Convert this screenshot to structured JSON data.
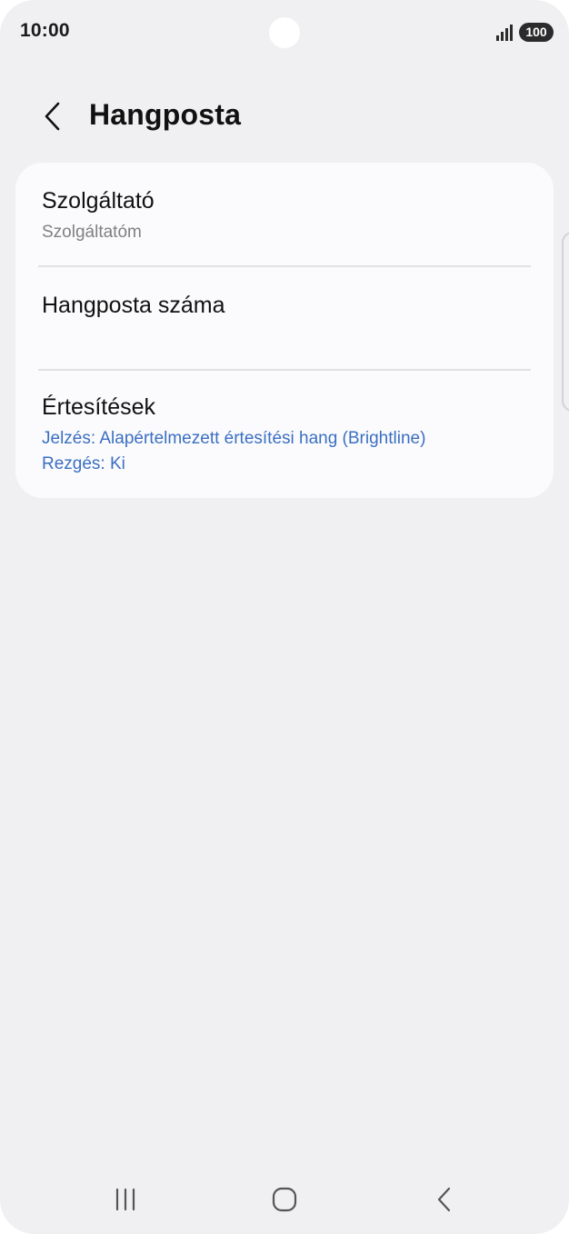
{
  "status_bar": {
    "time": "10:00",
    "battery": "100",
    "signal_icon": "signal-bars-icon"
  },
  "header": {
    "back_icon": "chevron-left-icon",
    "title": "Hangposta"
  },
  "settings": {
    "items": [
      {
        "title": "Szolgáltató",
        "subtitle": "Szolgáltatóm"
      },
      {
        "title": "Hangposta száma"
      },
      {
        "title": "Értesítések",
        "details": [
          "Jelzés: Alapértelmezett értesítési hang (Brightline)",
          "Rezgés: Ki"
        ]
      }
    ]
  },
  "nav_bar": {
    "recents_icon": "recents-icon",
    "home_icon": "home-icon",
    "back_icon": "back-icon"
  },
  "colors": {
    "background": "#f0f0f2",
    "card": "#fbfbfd",
    "accent_blue": "#3b6fc2",
    "secondary_text": "#808080"
  }
}
